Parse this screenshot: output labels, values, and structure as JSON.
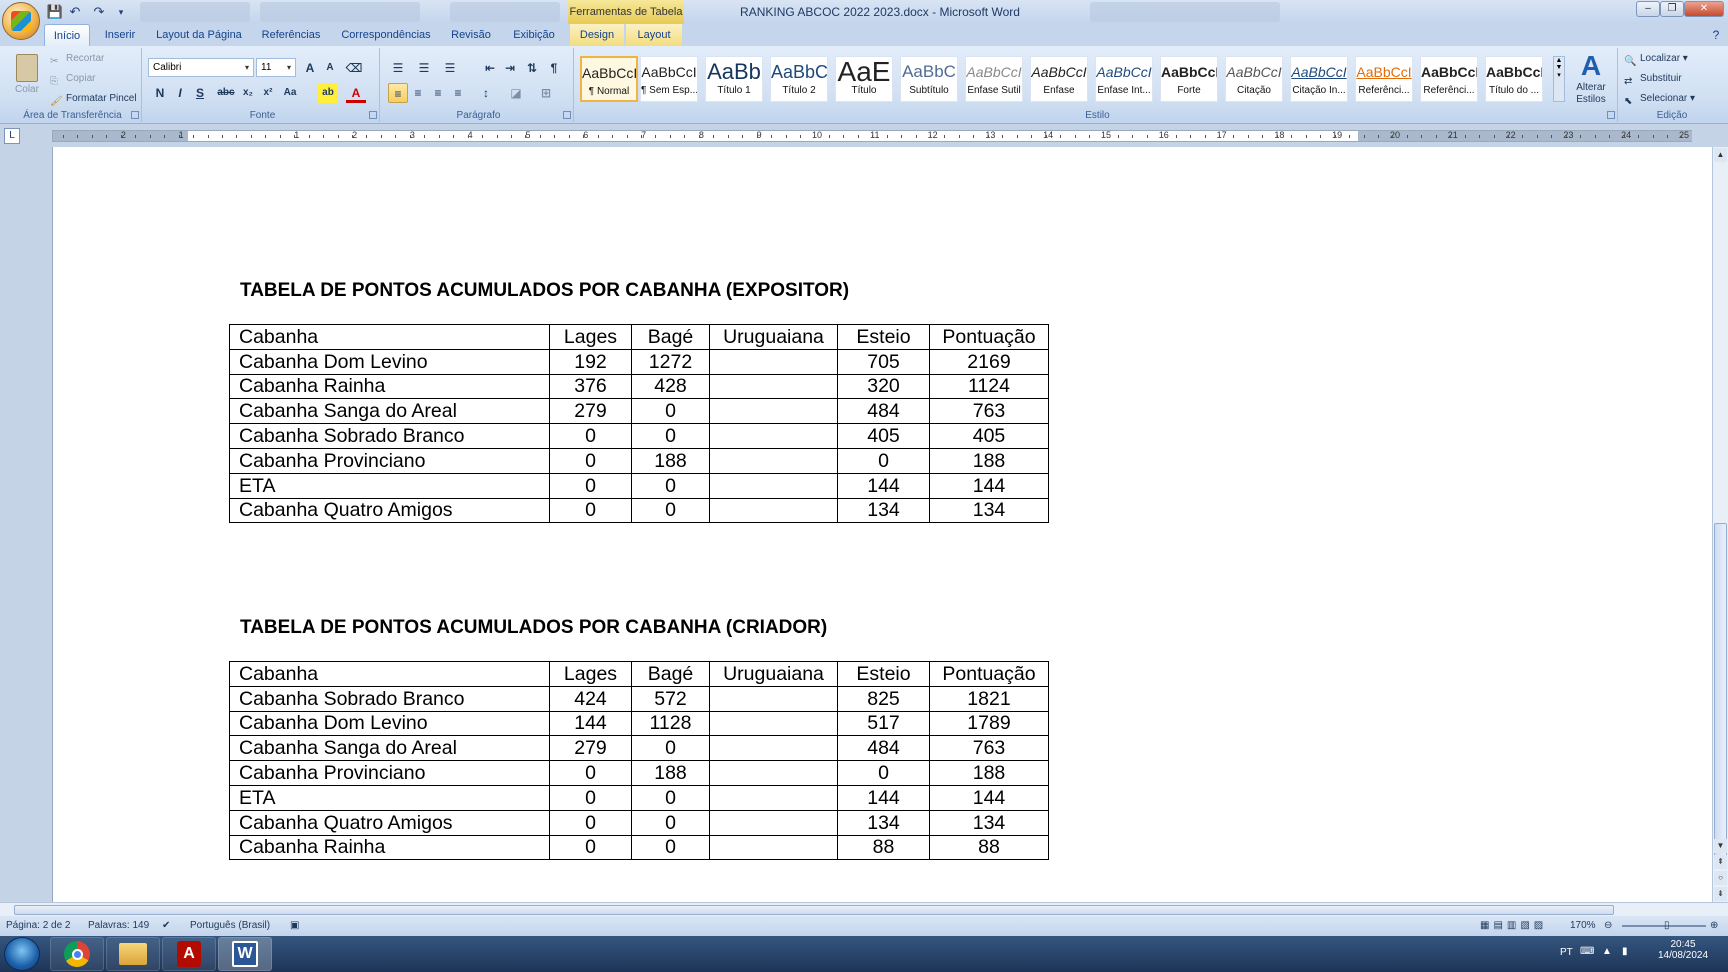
{
  "window": {
    "title": "RANKING ABCOC 2022 2023.docx - Microsoft Word",
    "contextual_tab_group": "Ferramentas de Tabela"
  },
  "ribbon_tabs": [
    "Início",
    "Inserir",
    "Layout da Página",
    "Referências",
    "Correspondências",
    "Revisão",
    "Exibição",
    "Design",
    "Layout"
  ],
  "clipboard": {
    "paste": "Colar",
    "cut": "Recortar",
    "copy": "Copiar",
    "format_painter": "Formatar Pincel",
    "group_title": "Área de Transferência"
  },
  "font": {
    "name": "Calibri",
    "size": "11",
    "group_title": "Fonte"
  },
  "paragraph": {
    "group_title": "Parágrafo"
  },
  "styles": {
    "group_title": "Estilo",
    "change_styles": "Alterar Estilos",
    "items": [
      {
        "sample": "AaBbCcI",
        "name": "¶ Normal"
      },
      {
        "sample": "AaBbCcI",
        "name": "¶ Sem Esp..."
      },
      {
        "sample": "AaBb",
        "name": "Título 1"
      },
      {
        "sample": "AaBbC",
        "name": "Título 2"
      },
      {
        "sample": "AaE",
        "name": "Título"
      },
      {
        "sample": "AaBbC",
        "name": "Subtítulo"
      },
      {
        "sample": "AaBbCcI",
        "name": "Ênfase Sutil"
      },
      {
        "sample": "AaBbCcI",
        "name": "Ênfase"
      },
      {
        "sample": "AaBbCcI",
        "name": "Ênfase Int..."
      },
      {
        "sample": "AaBbCcI",
        "name": "Forte"
      },
      {
        "sample": "AaBbCcI",
        "name": "Citação"
      },
      {
        "sample": "AaBbCcI",
        "name": "Citação In..."
      },
      {
        "sample": "AaBbCcI",
        "name": "Referênci..."
      },
      {
        "sample": "AaBbCcI",
        "name": "Referênci..."
      },
      {
        "sample": "AaBbCcI",
        "name": "Título do ..."
      }
    ]
  },
  "editing": {
    "group_title": "Edição",
    "find": "Localizar",
    "replace": "Substituir",
    "select": "Selecionar"
  },
  "ruler": {
    "labels": [
      "2",
      "1",
      "1",
      "2",
      "3",
      "4",
      "5",
      "6",
      "7",
      "8",
      "9",
      "10",
      "11",
      "12",
      "13",
      "14",
      "15",
      "16",
      "17",
      "18",
      "19",
      "20",
      "21",
      "22",
      "23",
      "24",
      "25",
      "26"
    ]
  },
  "document": {
    "table1": {
      "title": "TABELA DE PONTOS ACUMULADOS POR CABANHA (EXPOSITOR)",
      "headers": [
        "Cabanha",
        "Lages",
        "Bagé",
        "Uruguaiana",
        "Esteio",
        "Pontuação"
      ],
      "rows": [
        [
          "Cabanha Dom Levino",
          "192",
          "1272",
          "",
          "705",
          "2169"
        ],
        [
          "Cabanha Rainha",
          "376",
          "428",
          "",
          "320",
          "1124"
        ],
        [
          "Cabanha Sanga do Areal",
          "279",
          "0",
          "",
          "484",
          "763"
        ],
        [
          "Cabanha Sobrado Branco",
          "0",
          "0",
          "",
          "405",
          "405"
        ],
        [
          "Cabanha Provinciano",
          "0",
          "188",
          "",
          "0",
          "188"
        ],
        [
          "ETA",
          "0",
          "0",
          "",
          "144",
          "144"
        ],
        [
          "Cabanha Quatro Amigos",
          "0",
          "0",
          "",
          "134",
          "134"
        ]
      ]
    },
    "table2": {
      "title": "TABELA DE PONTOS ACUMULADOS POR CABANHA (CRIADOR)",
      "headers": [
        "Cabanha",
        "Lages",
        "Bagé",
        "Uruguaiana",
        "Esteio",
        "Pontuação"
      ],
      "rows": [
        [
          "Cabanha Sobrado Branco",
          "424",
          "572",
          "",
          "825",
          "1821"
        ],
        [
          "Cabanha Dom Levino",
          "144",
          "1128",
          "",
          "517",
          "1789"
        ],
        [
          "Cabanha Sanga do Areal",
          "279",
          "0",
          "",
          "484",
          "763"
        ],
        [
          "Cabanha Provinciano",
          "0",
          "188",
          "",
          "0",
          "188"
        ],
        [
          "ETA",
          "0",
          "0",
          "",
          "144",
          "144"
        ],
        [
          "Cabanha Quatro Amigos",
          "0",
          "0",
          "",
          "134",
          "134"
        ],
        [
          "Cabanha Rainha",
          "0",
          "0",
          "",
          "88",
          "88"
        ]
      ]
    }
  },
  "statusbar": {
    "page": "Página: 2 de 2",
    "words": "Palavras: 149",
    "language": "Português (Brasil)",
    "zoom": "170%"
  },
  "taskbar": {
    "language": "PT",
    "time": "20:45",
    "date": "14/08/2024"
  },
  "colors": {
    "ribbon_bg": "#dbe7f6",
    "accent": "#15428b",
    "contextual_tab": "#f2d770"
  }
}
